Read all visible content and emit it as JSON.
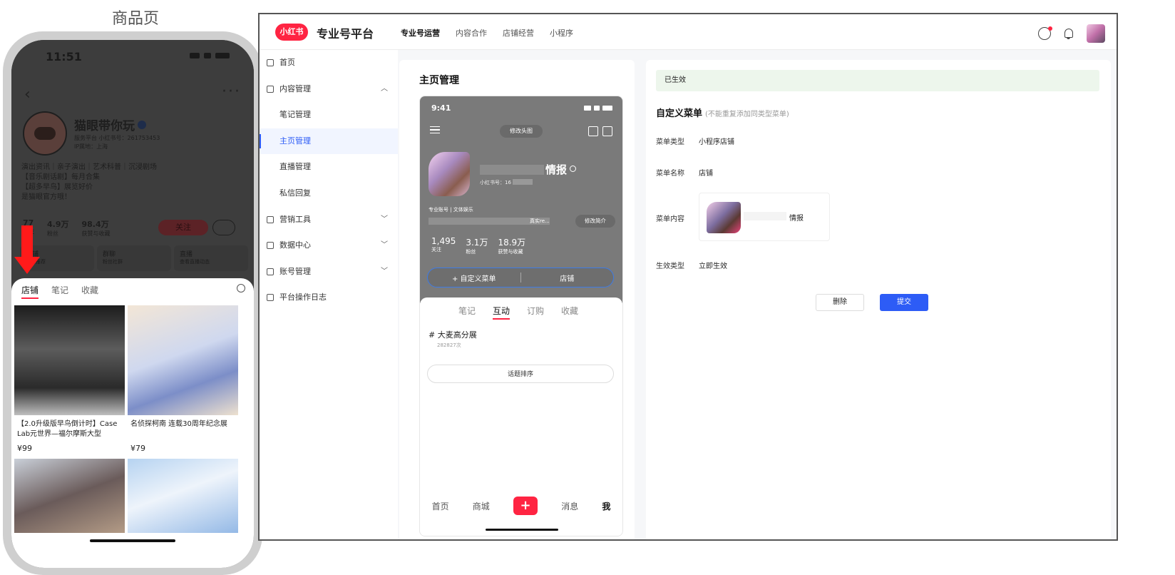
{
  "caption": "商品页",
  "phone": {
    "time": "11:51",
    "profile": {
      "name": "猫眼带你玩",
      "sub_line1": "服务平台  小红书号：261753453",
      "sub_line2": "IP属地：上海",
      "bio": [
        "演出资讯｜亲子演出｜艺术科普｜沉浸剧场",
        "【音乐剧话剧】每月合集",
        "【超多早鸟】展览好价",
        "是猫眼官方哦！"
      ],
      "stats": [
        {
          "value": "77",
          "label": "关注"
        },
        {
          "value": "4.9万",
          "label": "粉丝"
        },
        {
          "value": "98.4万",
          "label": "获赞与收藏"
        }
      ],
      "follow_label": "关注",
      "cards": [
        {
          "title": "店铺",
          "desc": "好物推荐"
        },
        {
          "title": "群聊",
          "desc": "粉丝社群"
        },
        {
          "title": "直播",
          "desc": "查看直播动态"
        }
      ]
    },
    "tabs": [
      "店铺",
      "笔记",
      "收藏"
    ],
    "products": [
      {
        "title": "【2.0升级版早鸟倒计时】Case Lab元世界—福尔摩斯大型",
        "price": "¥99",
        "image": "holmes-poster"
      },
      {
        "title": "名侦探柯南 连载30周年纪念展",
        "price": "¥79",
        "image": "conan-poster"
      },
      {
        "title": "",
        "price": "",
        "image": "concert-poster"
      },
      {
        "title": "",
        "price": "",
        "image": "portrait-poster"
      }
    ]
  },
  "window": {
    "logo": "小红书",
    "brand": "专业号平台",
    "nav": [
      "专业号运营",
      "内容合作",
      "店铺经营",
      "小程序"
    ],
    "sidebar": [
      {
        "label": "首页",
        "icon": "grid-icon",
        "type": "top"
      },
      {
        "label": "内容管理",
        "icon": "content-icon",
        "type": "group",
        "chevron": "up"
      },
      {
        "label": "笔记管理",
        "type": "sub"
      },
      {
        "label": "主页管理",
        "type": "sub",
        "active": true
      },
      {
        "label": "直播管理",
        "type": "sub"
      },
      {
        "label": "私信回复",
        "type": "sub"
      },
      {
        "label": "营销工具",
        "icon": "marketing-icon",
        "type": "group",
        "chevron": "down"
      },
      {
        "label": "数据中心",
        "icon": "chart-icon",
        "type": "group",
        "chevron": "down"
      },
      {
        "label": "账号管理",
        "icon": "account-icon",
        "type": "group",
        "chevron": "down"
      },
      {
        "label": "平台操作日志",
        "icon": "log-icon",
        "type": "top"
      }
    ],
    "preview": {
      "title": "主页管理",
      "time": "9:41",
      "edit_header": "修改头图",
      "name_visible": "情报",
      "id_label": "小红书号：16",
      "tags": "专业账号 | 文体娱乐",
      "desc_tail": "真实re...",
      "edit_intro": "修改简介",
      "stats": [
        {
          "value": "1,495",
          "label": "关注"
        },
        {
          "value": "3.1万",
          "label": "粉丝"
        },
        {
          "value": "18.9万",
          "label": "获赞与收藏"
        }
      ],
      "custom_menu_btn": "+ 自定义菜单",
      "shop_btn": "店铺",
      "tabs": [
        "笔记",
        "互动",
        "订购",
        "收藏"
      ],
      "topic": "# 大麦高分展",
      "topic_count": "282827次",
      "sort_btn": "话题排序",
      "footer": [
        "首页",
        "商城",
        "+",
        "消息",
        "我"
      ]
    },
    "settings": {
      "status": "已生效",
      "section_title": "自定义菜单",
      "section_hint": "(不能重复添加同类型菜单)",
      "rows": [
        {
          "label": "菜单类型",
          "value": "小程序店铺"
        },
        {
          "label": "菜单名称",
          "value": "店铺"
        },
        {
          "label": "菜单内容",
          "value": "情报"
        },
        {
          "label": "生效类型",
          "value": "立即生效"
        }
      ],
      "delete_label": "删除",
      "submit_label": "提交"
    }
  },
  "colors": {
    "brand_red": "#ff2442",
    "accent_blue": "#2d5cf6",
    "status_green_bg": "#edf6ec"
  }
}
